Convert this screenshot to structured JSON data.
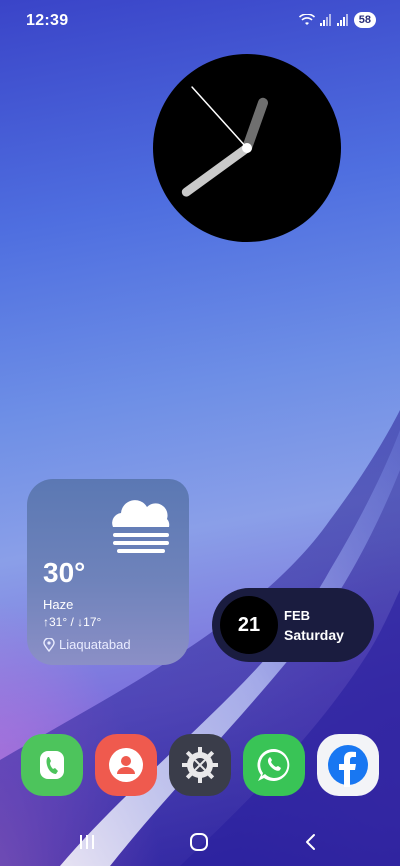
{
  "status_bar": {
    "time": "12:39",
    "battery": "58",
    "icons": [
      "wifi-icon",
      "signal-icon",
      "signal-icon"
    ]
  },
  "clock_widget": {
    "hour": 12,
    "minute": 39,
    "second": 53
  },
  "weather_widget": {
    "temperature": "30°",
    "condition": "Haze",
    "range": "↑31° / ↓17°",
    "location": "Liaquatabad",
    "icon": "haze-cloud-icon"
  },
  "date_widget": {
    "day_number": "21",
    "month": "FEB",
    "weekday": "Saturday"
  },
  "dock": {
    "apps": [
      {
        "name": "Phone",
        "icon": "phone-icon",
        "color": "#4dc45c"
      },
      {
        "name": "Contacts",
        "icon": "contacts-icon",
        "color": "#ef5a4e"
      },
      {
        "name": "Settings",
        "icon": "gear-icon",
        "color": "#3a3d4a"
      },
      {
        "name": "WhatsApp",
        "icon": "whatsapp-icon",
        "color": "#39c456"
      },
      {
        "name": "Facebook",
        "icon": "facebook-icon",
        "color": "#1877f2"
      }
    ]
  },
  "nav_bar": {
    "buttons": [
      "recents-icon",
      "home-icon",
      "back-icon"
    ]
  }
}
